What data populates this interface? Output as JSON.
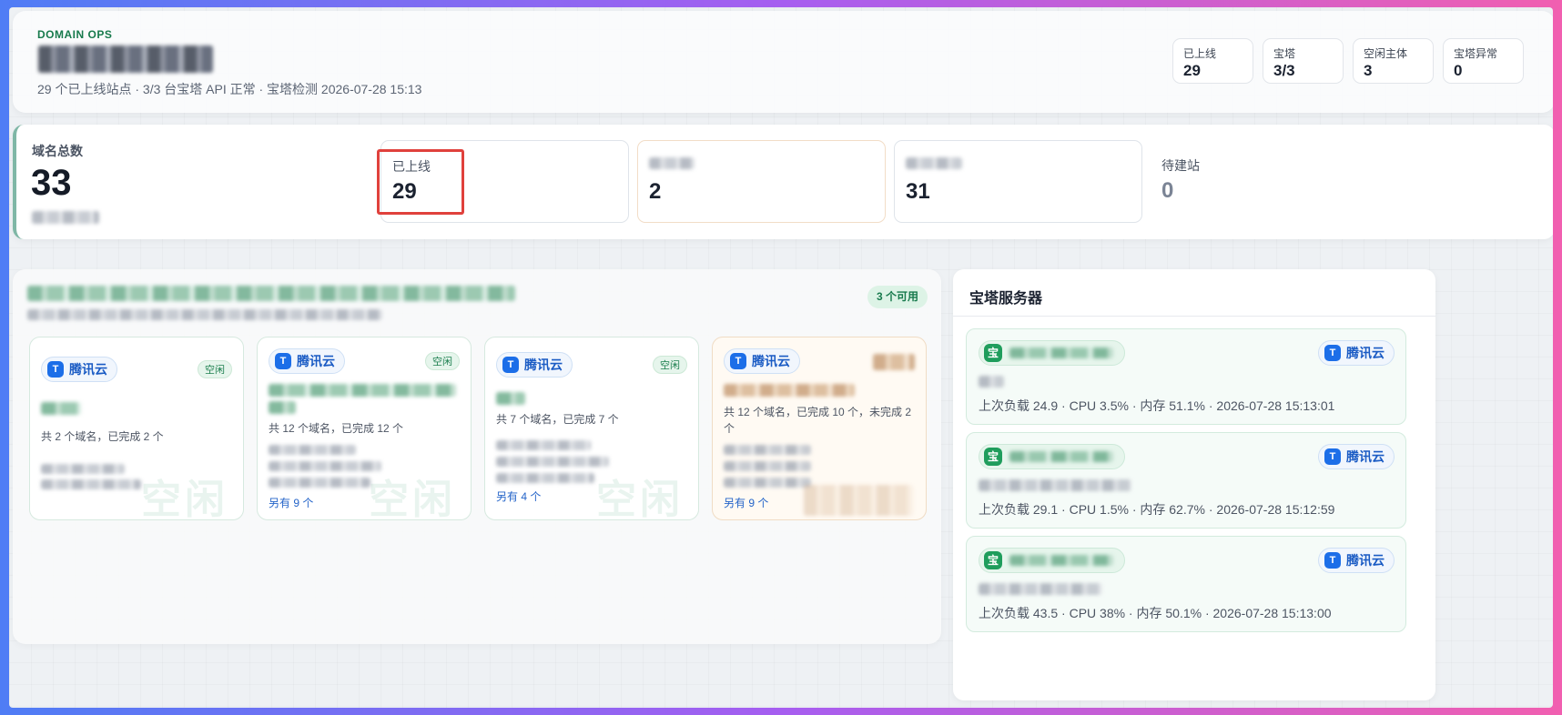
{
  "header": {
    "eyebrow": "DOMAIN OPS",
    "subtitle": "29 个已上线站点 · 3/3 台宝塔 API 正常 · 宝塔检测 2026-07-28 15:13",
    "pills": [
      {
        "label": "已上线",
        "value": "29"
      },
      {
        "label": "宝塔",
        "value": "3/3"
      },
      {
        "label": "空闲主体",
        "value": "3"
      },
      {
        "label": "宝塔异常",
        "value": "0"
      }
    ]
  },
  "summary": {
    "total_label": "域名总数",
    "total_value": "33",
    "stats": [
      {
        "label": "已上线",
        "value": "29"
      },
      {
        "label": "",
        "value": "2"
      },
      {
        "label": "",
        "value": "31"
      },
      {
        "label": "待建站",
        "value": "0"
      }
    ]
  },
  "entities": {
    "available_badge": "3 个可用",
    "cards": [
      {
        "provider": "腾讯云",
        "badge": "空闲",
        "info": "共 2 个域名，已完成 2 个",
        "more": "",
        "watermark": "空闲"
      },
      {
        "provider": "腾讯云",
        "badge": "空闲",
        "info": "共 12 个域名，已完成 12 个",
        "more": "另有 9 个",
        "watermark": "空闲"
      },
      {
        "provider": "腾讯云",
        "badge": "空闲",
        "info": "共 7 个域名，已完成 7 个",
        "more": "另有 4 个",
        "watermark": "空闲"
      },
      {
        "provider": "腾讯云",
        "badge": "",
        "info": "共 12 个域名，已完成 10 个，未完成 2 个",
        "more": "另有 9 个",
        "watermark": ""
      }
    ]
  },
  "servers": {
    "title": "宝塔服务器",
    "icon_glyph": "宝",
    "provider_glyph": "T",
    "items": [
      {
        "provider": "腾讯云",
        "meta": "上次负载 24.9 · CPU 3.5% · 内存 51.1% · 2026-07-28 15:13:01"
      },
      {
        "provider": "腾讯云",
        "meta": "上次负载 29.1 · CPU 1.5% · 内存 62.7% · 2026-07-28 15:12:59"
      },
      {
        "provider": "腾讯云",
        "meta": "上次负载 43.5 · CPU 38% · 内存 50.1% · 2026-07-28 15:13:00"
      }
    ]
  },
  "colors": {
    "accent_green": "#177a4c",
    "provider_blue": "#1c6ee8",
    "highlight_red": "#e0413c"
  }
}
